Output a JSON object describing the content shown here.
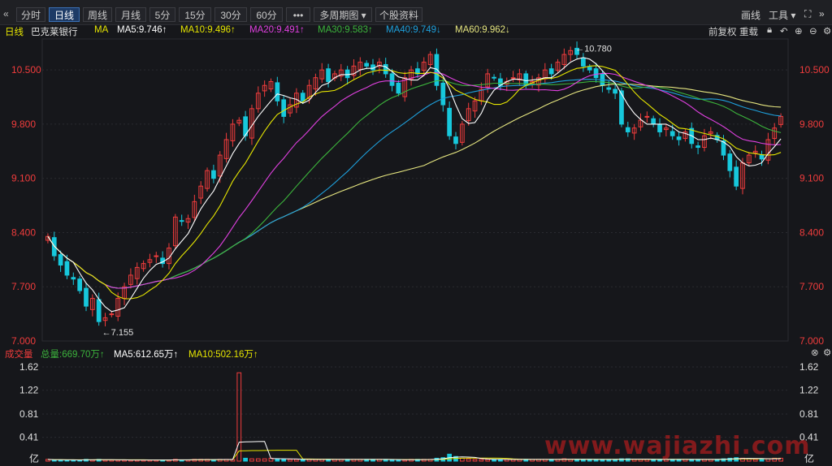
{
  "toolbar": {
    "back_icon": "«",
    "tabs": [
      {
        "label": "分时",
        "active": false
      },
      {
        "label": "日线",
        "active": true
      },
      {
        "label": "周线",
        "active": false
      },
      {
        "label": "月线",
        "active": false
      },
      {
        "label": "5分",
        "active": false
      },
      {
        "label": "15分",
        "active": false
      },
      {
        "label": "30分",
        "active": false
      },
      {
        "label": "60分",
        "active": false
      }
    ],
    "more_label": "•••",
    "multi_period_label": "多周期图 ▾",
    "stock_info_label": "个股资料",
    "draw_label": "画线",
    "tools_label": "工具 ▾",
    "fullscreen_icon": "⛶",
    "collapse_icon": "»"
  },
  "ma_bar": {
    "period": "日线",
    "stock_name": "巴克莱银行",
    "ma_label": "MA",
    "ma5": "MA5:9.746↑",
    "ma10": "MA10:9.496↑",
    "ma20": "MA20:9.491↑",
    "ma30": "MA30:9.583↑",
    "ma40": "MA40:9.749↓",
    "ma60": "MA60:9.962↓",
    "adjust_label": "前复权",
    "overlay_label": "重载"
  },
  "colors": {
    "ma5": "#ffffff",
    "ma10": "#e6e600",
    "ma20": "#e040e0",
    "ma30": "#3cb43c",
    "ma40": "#1ea0dc",
    "ma60": "#e6e680",
    "up": "#f03c3c",
    "down": "#17c8dc",
    "axis_text": "#f03c3c"
  },
  "price_axis": [
    "10.500",
    "9.800",
    "9.100",
    "8.400",
    "7.700",
    "7.000"
  ],
  "annotations": {
    "high": "←10.780",
    "low": "←7.155"
  },
  "volume_bar": {
    "title": "成交量",
    "total": "总量:669.70万↑",
    "ma5": "MA5:612.65万↑",
    "ma10": "MA10:502.16万↑",
    "unit": "亿"
  },
  "volume_axis": [
    "1.62",
    "1.22",
    "0.81",
    "0.41"
  ],
  "watermark": "www.wajiazhi.com",
  "chart_data": {
    "type": "candlestick",
    "ylim": [
      7.0,
      10.9
    ],
    "ma_values": {
      "MA5": 9.746,
      "MA10": 9.496,
      "MA20": 9.491,
      "MA30": 9.583,
      "MA40": 9.749,
      "MA60": 9.962
    },
    "high_label": 10.78,
    "low_label": 7.155,
    "closes": [
      8.35,
      8.1,
      7.98,
      7.85,
      7.8,
      7.65,
      7.45,
      7.55,
      7.25,
      7.3,
      7.35,
      7.55,
      7.7,
      7.85,
      7.95,
      8.0,
      8.05,
      8.1,
      8.0,
      8.2,
      8.6,
      8.55,
      8.58,
      8.8,
      9.0,
      9.2,
      9.1,
      9.4,
      9.6,
      9.8,
      9.85,
      9.65,
      10.0,
      10.2,
      10.3,
      10.35,
      10.1,
      9.9,
      10.05,
      10.2,
      10.1,
      10.3,
      10.4,
      10.5,
      10.35,
      10.45,
      10.5,
      10.4,
      10.55,
      10.6,
      10.55,
      10.5,
      10.6,
      10.45,
      10.3,
      10.2,
      10.4,
      10.5,
      10.45,
      10.6,
      10.7,
      10.3,
      10.05,
      9.65,
      9.55,
      9.8,
      10.0,
      10.1,
      10.25,
      10.45,
      10.4,
      10.3,
      10.35,
      10.4,
      10.45,
      10.3,
      10.35,
      10.4,
      10.5,
      10.45,
      10.6,
      10.7,
      10.75,
      10.7,
      10.55,
      10.5,
      10.4,
      10.3,
      10.25,
      10.2,
      9.8,
      9.7,
      9.75,
      9.85,
      9.9,
      9.8,
      9.7,
      9.75,
      9.65,
      9.6,
      9.7,
      9.55,
      9.5,
      9.65,
      9.7,
      9.6,
      9.4,
      9.2,
      9.0,
      9.3,
      9.4,
      9.45,
      9.35,
      9.6,
      9.75,
      9.9
    ],
    "volumes": [
      0.03,
      0.02,
      0.02,
      0.02,
      0.02,
      0.02,
      0.03,
      0.02,
      0.03,
      0.02,
      0.02,
      0.02,
      0.02,
      0.02,
      0.02,
      0.02,
      0.02,
      0.02,
      0.02,
      0.02,
      0.03,
      0.02,
      0.02,
      0.03,
      0.03,
      0.03,
      0.02,
      0.03,
      0.03,
      0.03,
      1.52,
      0.05,
      0.04,
      0.04,
      0.04,
      0.05,
      0.04,
      0.03,
      0.03,
      0.03,
      0.03,
      0.03,
      0.03,
      0.03,
      0.03,
      0.03,
      0.03,
      0.03,
      0.03,
      0.03,
      0.03,
      0.03,
      0.03,
      0.03,
      0.02,
      0.02,
      0.02,
      0.03,
      0.03,
      0.03,
      0.03,
      0.05,
      0.06,
      0.12,
      0.08,
      0.05,
      0.04,
      0.03,
      0.03,
      0.03,
      0.03,
      0.03,
      0.03,
      0.03,
      0.03,
      0.03,
      0.03,
      0.03,
      0.03,
      0.03,
      0.03,
      0.04,
      0.03,
      0.03,
      0.03,
      0.03,
      0.03,
      0.03,
      0.03,
      0.03,
      0.04,
      0.04,
      0.03,
      0.03,
      0.03,
      0.03,
      0.03,
      0.03,
      0.03,
      0.03,
      0.03,
      0.03,
      0.03,
      0.03,
      0.03,
      0.03,
      0.04,
      0.05,
      0.06,
      0.05,
      0.04,
      0.03,
      0.04,
      0.04,
      0.05,
      0.05
    ]
  }
}
